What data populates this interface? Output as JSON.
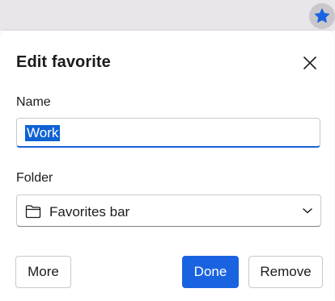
{
  "toolbar": {
    "favorite_star_icon": "star-filled-icon",
    "accent_color": "#1a63e0"
  },
  "dialog": {
    "title": "Edit favorite",
    "close_icon": "close-icon",
    "name_label": "Name",
    "name_value": "Work",
    "folder_label": "Folder",
    "folder_value": "Favorites bar",
    "folder_icon": "folder-icon",
    "dropdown_icon": "chevron-down-icon",
    "buttons": {
      "more": "More",
      "done": "Done",
      "remove": "Remove"
    }
  }
}
